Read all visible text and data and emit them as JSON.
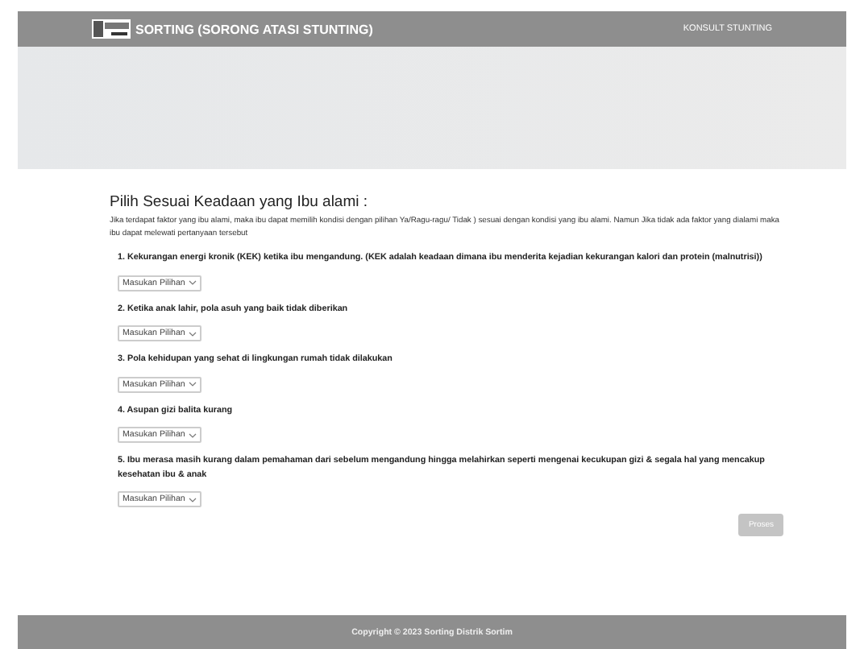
{
  "navbar": {
    "title": "SORTING (SORONG ATASI STUNTING)",
    "link": "KONSULT STUNTING"
  },
  "heading": "Pilih Sesuai Keadaan yang Ibu alami :",
  "intro": "Jika terdapat faktor yang ibu alami, maka ibu dapat memilih kondisi dengan pilihan Ya/Ragu-ragu/ Tidak ) sesuai dengan kondisi yang ibu alami. Namun Jika tidak ada faktor yang dialami maka ibu dapat melewati pertanyaan tersebut",
  "questions": [
    {
      "text": "1. Kekurangan energi kronik (KEK) ketika ibu mengandung. (KEK adalah keadaan dimana ibu menderita kejadian kekurangan kalori dan protein (malnutrisi))",
      "select": "Masukan Pilihan"
    },
    {
      "text": "2. Ketika anak lahir, pola asuh yang baik tidak diberikan",
      "select": "Masukan Pilihan"
    },
    {
      "text": "3. Pola kehidupan yang sehat di lingkungan rumah tidak dilakukan",
      "select": "Masukan Pilihan"
    },
    {
      "text": "4. Asupan gizi balita kurang",
      "select": "Masukan Pilihan"
    },
    {
      "text": "5. Ibu merasa masih kurang dalam pemahaman dari sebelum mengandung hingga melahirkan seperti mengenai kecukupan gizi & segala hal yang mencakup kesehatan ibu & anak",
      "select": "Masukan Pilihan"
    }
  ],
  "submit": {
    "label": "Proses",
    "disabled": true
  },
  "footer": "Copyright © 2023 Sorting Distrik Sortim"
}
